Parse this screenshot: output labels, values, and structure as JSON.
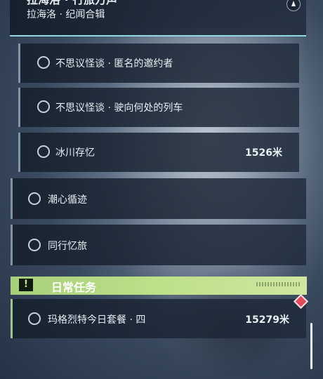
{
  "header": {
    "title_clipped": "拉海洛 · 行旅万声",
    "subtitle": "拉海洛 · 纪闻合辑",
    "compass_icon": "compass-icon"
  },
  "quests": {
    "sub_items": [
      {
        "label": "不思议怪谈 · 匿名的邀约者",
        "distance": ""
      },
      {
        "label": "不思议怪谈 · 驶向何处的列车",
        "distance": ""
      },
      {
        "label": "冰川存忆",
        "distance": "1526米"
      }
    ],
    "main_items": [
      {
        "label": "潮心循迹"
      },
      {
        "label": "同行忆旅"
      }
    ]
  },
  "daily_section": {
    "icon": "!",
    "title": "日常任务",
    "accent_color": "#bde089"
  },
  "daily_items": [
    {
      "label": "玛格烈特今日套餐 · 四",
      "distance": "15279米",
      "tracked_icon": "red-diamond-icon"
    }
  ],
  "colors": {
    "row_bg": "#1c2a3a",
    "divider_accent": "#8fd8e6",
    "daily_accent": "#9ec58e",
    "marker": "#e34b5c"
  }
}
